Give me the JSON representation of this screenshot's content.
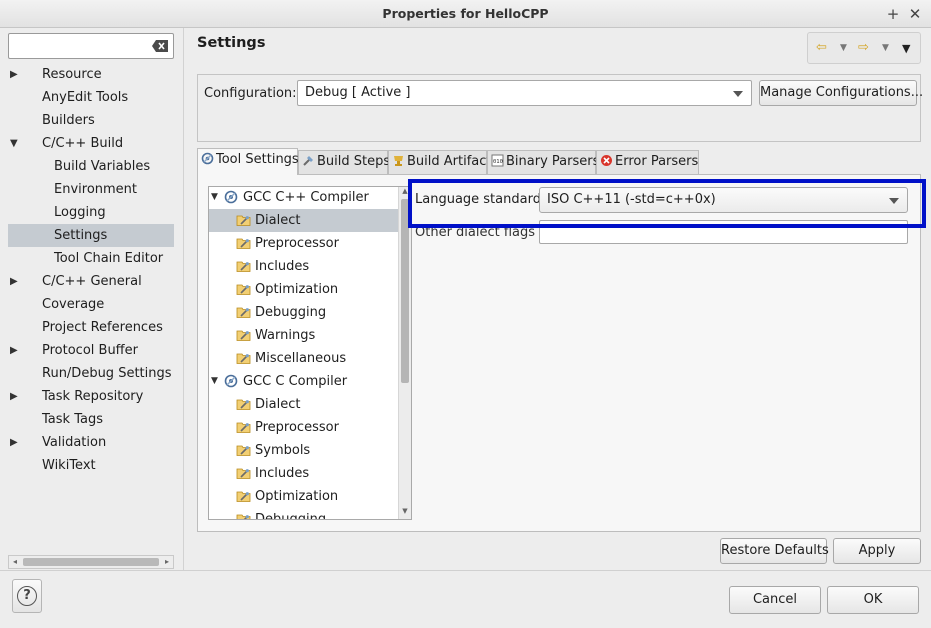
{
  "window": {
    "title": "Properties for HelloCPP",
    "plus_glyph": "+",
    "close_glyph": "✕"
  },
  "sidebar": {
    "filter_value": "",
    "items": [
      {
        "label": "Resource",
        "arrow": "▶"
      },
      {
        "label": "AnyEdit Tools",
        "arrow": ""
      },
      {
        "label": "Builders",
        "arrow": ""
      },
      {
        "label": "C/C++ Build",
        "arrow": "▼"
      },
      {
        "label": "Build Variables",
        "arrow": ""
      },
      {
        "label": "Environment",
        "arrow": ""
      },
      {
        "label": "Logging",
        "arrow": ""
      },
      {
        "label": "Settings",
        "arrow": ""
      },
      {
        "label": "Tool Chain Editor",
        "arrow": ""
      },
      {
        "label": "C/C++ General",
        "arrow": "▶"
      },
      {
        "label": "Coverage",
        "arrow": ""
      },
      {
        "label": "Project References",
        "arrow": ""
      },
      {
        "label": "Protocol Buffer",
        "arrow": "▶"
      },
      {
        "label": "Run/Debug Settings",
        "arrow": ""
      },
      {
        "label": "Task Repository",
        "arrow": "▶"
      },
      {
        "label": "Task Tags",
        "arrow": ""
      },
      {
        "label": "Validation",
        "arrow": "▶"
      },
      {
        "label": "WikiText",
        "arrow": ""
      }
    ],
    "selected": "Settings"
  },
  "main": {
    "title": "Settings",
    "nav": {
      "back": "⇦",
      "forward": "⇨",
      "dropdown": "▼",
      "menu": "▼"
    },
    "configuration": {
      "label": "Configuration:",
      "value": "Debug  [ Active ]",
      "manage_button": "Manage Configurations..."
    },
    "tabs": [
      {
        "label": "Tool Settings"
      },
      {
        "label": "Build Steps"
      },
      {
        "label": "Build Artifact"
      },
      {
        "label": "Binary Parsers"
      },
      {
        "label": "Error Parsers"
      }
    ],
    "tool_tree": [
      {
        "label": "GCC C++ Compiler",
        "kind": "tool",
        "twisty": "▼"
      },
      {
        "label": "Dialect",
        "kind": "option"
      },
      {
        "label": "Preprocessor",
        "kind": "option"
      },
      {
        "label": "Includes",
        "kind": "option"
      },
      {
        "label": "Optimization",
        "kind": "option"
      },
      {
        "label": "Debugging",
        "kind": "option"
      },
      {
        "label": "Warnings",
        "kind": "option"
      },
      {
        "label": "Miscellaneous",
        "kind": "option"
      },
      {
        "label": "GCC C Compiler",
        "kind": "tool",
        "twisty": "▼"
      },
      {
        "label": "Dialect",
        "kind": "option"
      },
      {
        "label": "Preprocessor",
        "kind": "option"
      },
      {
        "label": "Symbols",
        "kind": "option"
      },
      {
        "label": "Includes",
        "kind": "option"
      },
      {
        "label": "Optimization",
        "kind": "option"
      },
      {
        "label": "Debugging",
        "kind": "option"
      }
    ],
    "scroll_up": "▲",
    "scroll_down": "▼",
    "dialect": {
      "language_label": "Language standard",
      "language_value": "ISO C++11 (-std=c++0x)",
      "other_label": "Other dialect flags",
      "other_value": ""
    },
    "restore_defaults": "Restore Defaults",
    "apply": "Apply"
  },
  "bottom": {
    "help": "?",
    "cancel": "Cancel",
    "ok": "OK"
  },
  "colors": {
    "highlight": "#0010c8",
    "selection": "#c5cbd1",
    "nav_arrow": "#d4a526"
  }
}
